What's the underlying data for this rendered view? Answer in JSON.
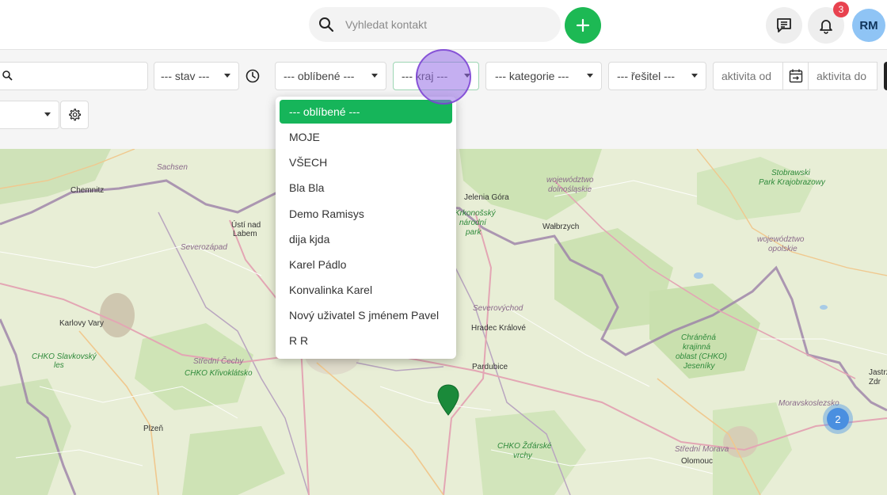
{
  "search": {
    "placeholder": "Vyhledat kontakt"
  },
  "notifications": {
    "count": "3"
  },
  "user": {
    "initials": "RM"
  },
  "filters": {
    "stav": "--- stav ---",
    "oblibene": "--- oblíbené ---",
    "kraj": "--- kraj ---",
    "kategorie": "--- kategorie ---",
    "resitel": "--- řešitel ---",
    "aktivita_od_placeholder": "aktivita od",
    "aktivita_do_placeholder": "aktivita do"
  },
  "dropdown": {
    "items": [
      "--- oblíbené ---",
      "MOJE",
      "VŠECH",
      "Bla Bla",
      "Demo Ramisys",
      "dija kjda",
      "Karel Pádlo",
      "Konvalinka Karel",
      "Nový uživatel S jménem Pavel",
      "R R"
    ]
  },
  "map": {
    "cluster_count": "2",
    "labels": {
      "sachsen": "Sachsen",
      "chemnitz": "Chemnitz",
      "usti": "Ústí nad",
      "labem": "Labem",
      "severozapad": "Severozápad",
      "karlovy_vary": "Karlovy Vary",
      "chko_slavkovsky": "CHKO Slavkovský",
      "les": "les",
      "stredni_cechy": "Střední Čechy",
      "chko_krivoklatsko": "CHKO Křivoklátsko",
      "plzen": "Plzeň",
      "jelenia_gora": "Jelenia Góra",
      "walbrzych": "Wałbrzych",
      "woj_dolnoslaskie_1": "województwo",
      "woj_dolnoslaskie_2": "dolnośląskie",
      "krkonossky_1": "Krkonošský",
      "krkonossky_2": "národní",
      "krkonossky_3": "park",
      "severovychod": "Severovýchod",
      "hradec": "Hradec Králové",
      "pardubice": "Pardubice",
      "chko_zdarske_1": "CHKO Žďárské",
      "chko_zdarske_2": "vrchy",
      "stobrawski_1": "Stobrawski",
      "stobrawski_2": "Park Krajobrazowy",
      "woj_opolskie_1": "województwo",
      "woj_opolskie_2": "opolskie",
      "chko_jeseniky_1": "Chráněná",
      "chko_jeseniky_2": "krajinná",
      "chko_jeseniky_3": "oblast (CHKO)",
      "chko_jeseniky_4": "Jeseníky",
      "moravskoslezsko": "Moravskoslezsko",
      "stredni_morava": "Střední Morava",
      "olomouc": "Olomouc",
      "jastrz_1": "Jastrz",
      "jastrz_2": "Zdr"
    }
  },
  "colors": {
    "accent_green": "#16b55a",
    "badge_red": "#e8424f",
    "avatar_blue": "#8fc4f5",
    "cluster_blue": "#4a8fe0",
    "marker_green": "#1a8a3a"
  }
}
